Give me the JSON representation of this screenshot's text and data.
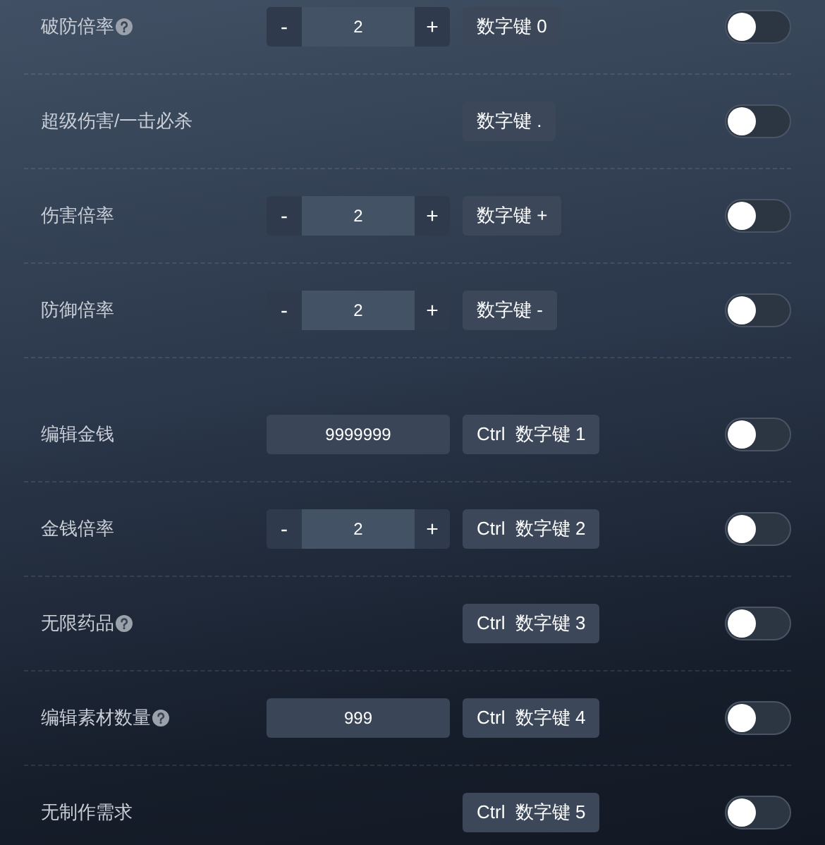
{
  "groups": [
    {
      "rows": [
        {
          "label": "破防倍率",
          "help": true,
          "control": {
            "kind": "stepper",
            "minus": "-",
            "value": "2",
            "plus": "+"
          },
          "hotkey": "数字键 0",
          "on": false
        },
        {
          "label": "超级伤害/一击必杀",
          "help": false,
          "hotkey": "数字键 .",
          "on": false
        },
        {
          "label": "伤害倍率",
          "help": false,
          "control": {
            "kind": "stepper",
            "minus": "-",
            "value": "2",
            "plus": "+"
          },
          "hotkey": "数字键 +",
          "on": false
        },
        {
          "label": "防御倍率",
          "help": false,
          "control": {
            "kind": "stepper",
            "minus": "-",
            "value": "2",
            "plus": "+"
          },
          "hotkey": "数字键 -",
          "on": false
        }
      ]
    },
    {
      "rows": [
        {
          "label": "编辑金钱",
          "help": false,
          "control": {
            "kind": "input",
            "value": "9999999"
          },
          "hotkey": "Ctrl  数字键 1",
          "on": false
        },
        {
          "label": "金钱倍率",
          "help": false,
          "control": {
            "kind": "stepper",
            "minus": "-",
            "value": "2",
            "plus": "+"
          },
          "hotkey": "Ctrl  数字键 2",
          "on": false
        },
        {
          "label": "无限药品",
          "help": true,
          "hotkey": "Ctrl  数字键 3",
          "on": false
        },
        {
          "label": "编辑素材数量",
          "help": true,
          "control": {
            "kind": "input",
            "value": "999"
          },
          "hotkey": "Ctrl  数字键 4",
          "on": false
        },
        {
          "label": "无制作需求",
          "help": false,
          "hotkey": "Ctrl  数字键 5",
          "on": false
        }
      ]
    }
  ]
}
